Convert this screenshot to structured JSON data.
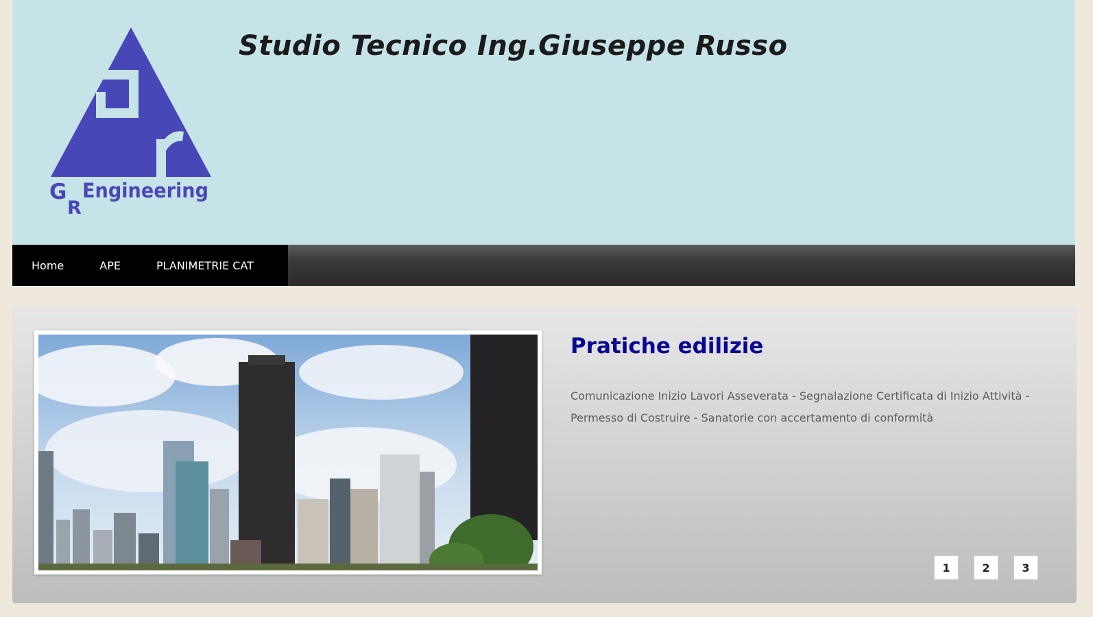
{
  "header": {
    "site_title": "Studio Tecnico Ing.Giuseppe Russo",
    "logo": {
      "word_g": "G",
      "word_r": "R",
      "word_engineering": "Engineering",
      "color": "#4747b8"
    },
    "background": "#c6e3e8"
  },
  "nav": {
    "items": [
      {
        "label": "Home"
      },
      {
        "label": "APE"
      },
      {
        "label": "PLANIMETRIE CAT"
      }
    ]
  },
  "slider": {
    "image": "city-skyline-photo",
    "title": "Pratiche edilizie",
    "text": "Comunicazione Inizio Lavori Asseverata - Segnalazione Certificata di Inizio Attività - Permesso di Costruire - Sanatorie con accertamento di conformità",
    "title_color": "#08088f",
    "pager": [
      "1",
      "2",
      "3"
    ],
    "active_page": "1"
  }
}
